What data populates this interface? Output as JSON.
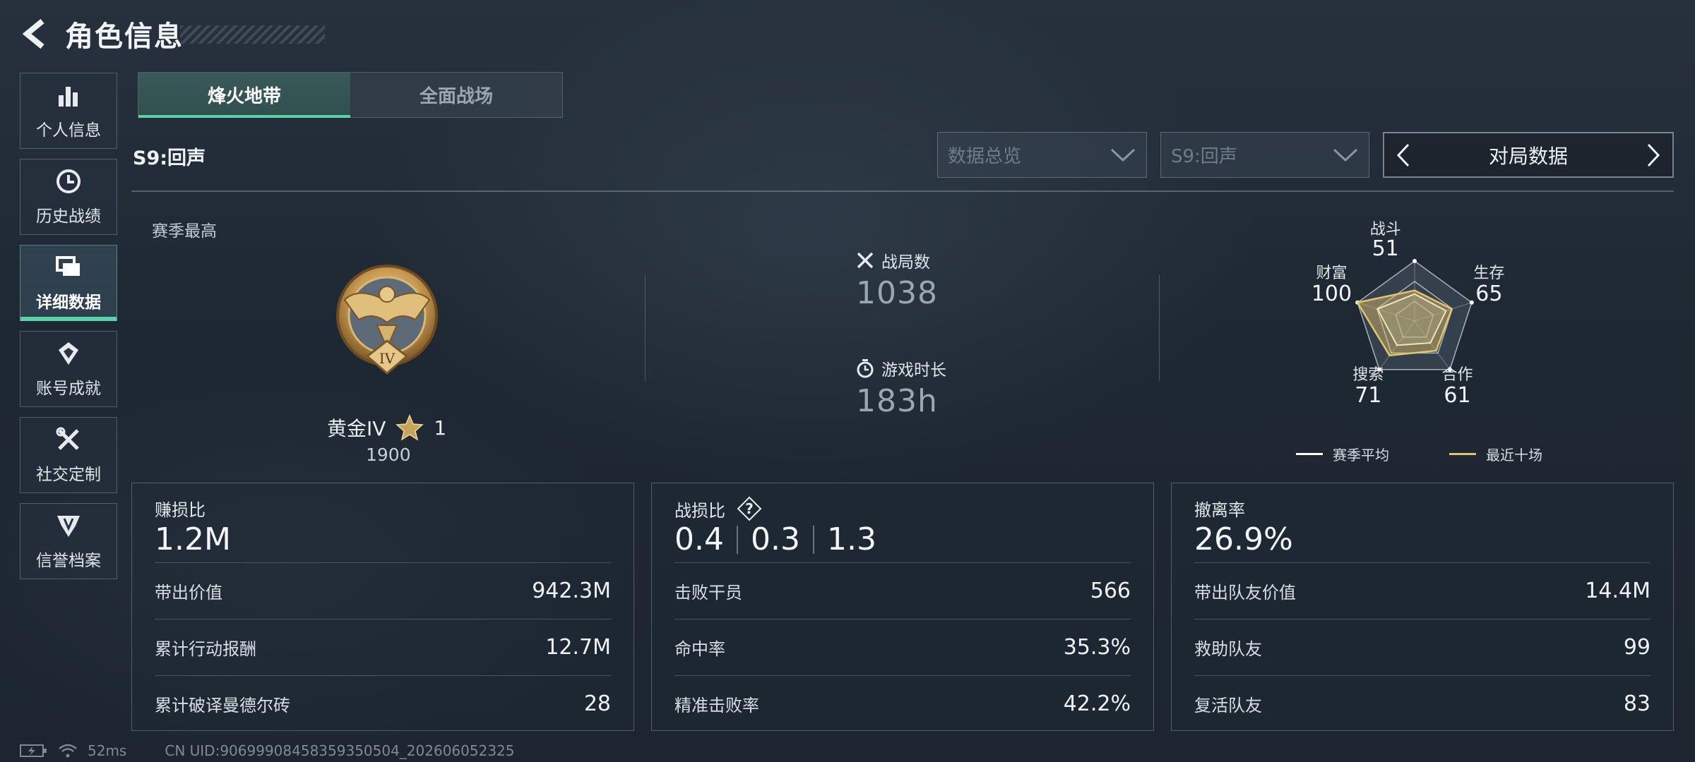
{
  "header": {
    "title": "角色信息"
  },
  "sidebar": {
    "items": [
      {
        "label": "个人信息",
        "icon": "bar-chart-icon"
      },
      {
        "label": "历史战绩",
        "icon": "history-clock-icon"
      },
      {
        "label": "详细数据",
        "icon": "cards-icon",
        "active": true
      },
      {
        "label": "账号成就",
        "icon": "achievement-icon"
      },
      {
        "label": "社交定制",
        "icon": "tools-icon"
      },
      {
        "label": "信誉档案",
        "icon": "shield-wing-icon"
      }
    ]
  },
  "mode_tabs": [
    {
      "label": "烽火地带",
      "active": true
    },
    {
      "label": "全面战场",
      "active": false
    }
  ],
  "season_label": "S9:回声",
  "filters": {
    "overview": "数据总览",
    "season": "S9:回声",
    "switcher": "对局数据"
  },
  "rank": {
    "season_best_label": "赛季最高",
    "tier": "黄金IV",
    "medal_numeral": "IV",
    "stars": "1",
    "score": "1900"
  },
  "counts": {
    "matches_label": "战局数",
    "matches_value": "1038",
    "playtime_label": "游戏时长",
    "playtime_value": "183h"
  },
  "radar": {
    "axes": [
      {
        "label": "战斗",
        "value": "51"
      },
      {
        "label": "生存",
        "value": "65"
      },
      {
        "label": "合作",
        "value": "61"
      },
      {
        "label": "搜索",
        "value": "71"
      },
      {
        "label": "财富",
        "value": "100"
      }
    ],
    "season_avg": [
      0.45,
      0.55,
      0.45,
      0.5,
      0.65
    ],
    "recent_ten": [
      0.51,
      0.65,
      0.61,
      0.71,
      1.0
    ],
    "legend_avg": "赛季平均",
    "legend_recent": "最近十场",
    "avg_color": "#ffffff",
    "recent_color": "#e3c46a"
  },
  "cards": {
    "profit": {
      "title": "赚损比",
      "value": "1.2M",
      "rows": [
        {
          "k": "带出价值",
          "v": "942.3M"
        },
        {
          "k": "累计行动报酬",
          "v": "12.7M"
        },
        {
          "k": "累计破译曼德尔砖",
          "v": "28"
        }
      ]
    },
    "kd": {
      "title": "战损比",
      "values": [
        "0.4",
        "0.3",
        "1.3"
      ],
      "rows": [
        {
          "k": "击败干员",
          "v": "566"
        },
        {
          "k": "命中率",
          "v": "35.3%"
        },
        {
          "k": "精准击败率",
          "v": "42.2%"
        }
      ]
    },
    "extract": {
      "title": "撤离率",
      "value": "26.9%",
      "rows": [
        {
          "k": "带出队友价值",
          "v": "14.4M"
        },
        {
          "k": "救助队友",
          "v": "99"
        },
        {
          "k": "复活队友",
          "v": "83"
        }
      ]
    }
  },
  "footer": {
    "ping": "52ms",
    "uid": "CN UID:90699908458359350504_202606052325"
  },
  "colors": {
    "accent": "#5ad3a6",
    "gold": "#c9a45c"
  }
}
